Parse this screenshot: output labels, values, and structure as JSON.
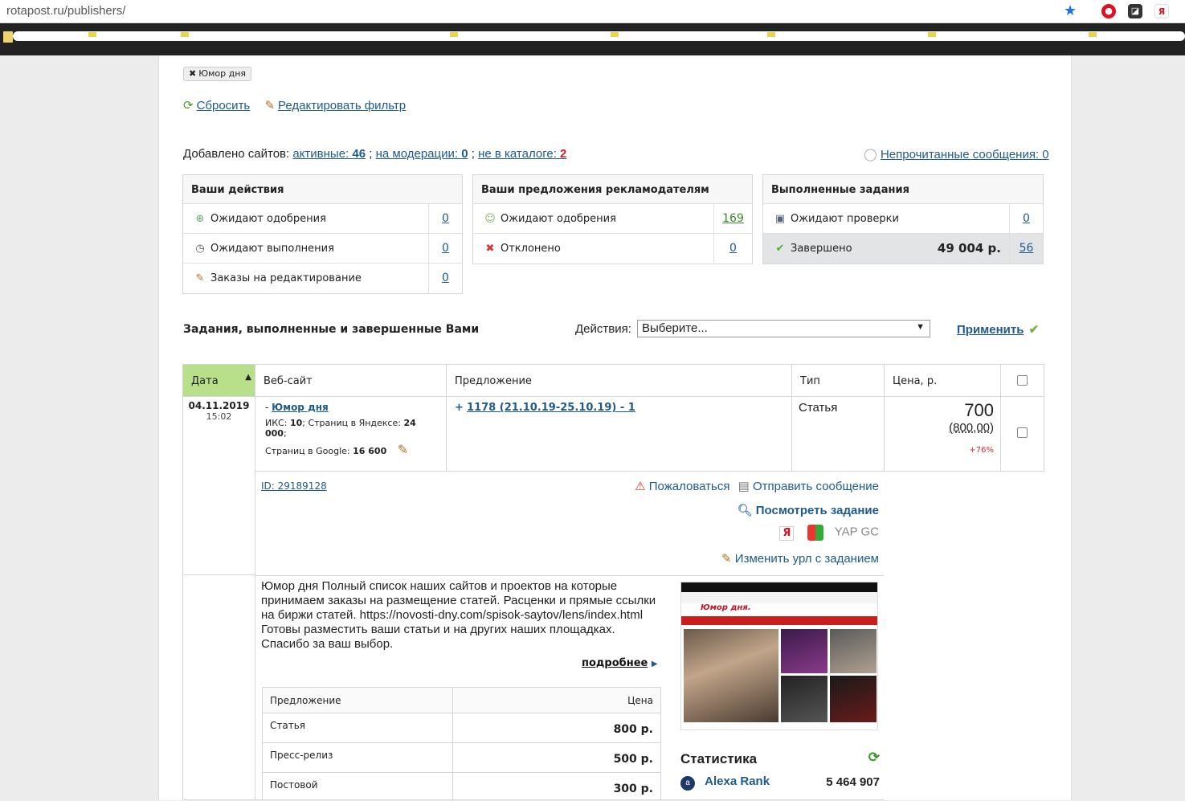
{
  "browser": {
    "url": "rotapost.ru/publishers/",
    "ext1": "●",
    "ext2": "◪",
    "ext3": "Я"
  },
  "filter": {
    "tag": "Юмор дня",
    "reset": "Сбросить",
    "edit": "Редактировать фильтр"
  },
  "sites": {
    "label": "Добавлено сайтов:",
    "active_label": "активные:",
    "active_count": "46",
    "moderation_label": "на модерации:",
    "moderation_count": "0",
    "not_catalog_label": "не в каталоге:",
    "not_catalog_count": "2",
    "sep": ";",
    "unread": "Непрочитанные сообщения: 0"
  },
  "panels": {
    "actions": {
      "title": "Ваши действия",
      "rows": [
        {
          "label": "Ожидают одобрения",
          "count": "0"
        },
        {
          "label": "Ожидают выполнения",
          "count": "0"
        },
        {
          "label": "Заказы на редактирование",
          "count": "0"
        }
      ]
    },
    "offers": {
      "title": "Ваши предложения рекламодателям",
      "rows": [
        {
          "label": "Ожидают одобрения",
          "count": "169"
        },
        {
          "label": "Отклонено",
          "count": "0"
        }
      ]
    },
    "completed": {
      "title": "Выполненные задания",
      "rows": [
        {
          "label": "Ожидают проверки",
          "count": "0"
        },
        {
          "label": "Завершено",
          "sum": "49 004 р.",
          "count": "56"
        }
      ]
    }
  },
  "section": {
    "title": "Задания, выполненные и завершенные Вами",
    "actions_label": "Действия:",
    "select_value": "Выберите...",
    "apply": "Применить"
  },
  "table": {
    "headers": {
      "date": "Дата",
      "site": "Веб-сайт",
      "offer": "Предложение",
      "type": "Тип",
      "price": "Цена, р."
    },
    "row": {
      "date": "04.11.2019",
      "time": "15:02",
      "site_prefix": "-",
      "site_name": "Юмор дня",
      "iks_label": "ИКС:",
      "iks": "10",
      "yandex_label": "; Страниц в Яндексе:",
      "yandex": "24 000",
      "yandex_end": ";",
      "google_label": "Страниц в Google:",
      "google": "16 600",
      "offer_prefix": "+",
      "offer_link": "1178 (21.10.19-25.10.19) - 1",
      "type": "Статья",
      "price": "700",
      "price_orig": "(800,00)",
      "percent": "+76%",
      "id": "ID: 29189128",
      "complain": "Пожаловаться",
      "send_message": "Отправить сообщение",
      "view_task": "Посмотреть задание",
      "yap": "YAP GC",
      "change_url": "Изменить урл с заданием"
    }
  },
  "detail": {
    "description": "Юмор дня Полный список наших сайтов и проектов на которые принимаем заказы на размещение статей. Расценки и прямые ссылки на биржи статей. https://novosti-dny.com/spisok-saytov/lens/index.html Готовы разместить ваши статьи и на других наших площадках. Спасибо за ваш выбор.",
    "more": "подробнее",
    "price_table": {
      "head_offer": "Предложение",
      "head_price": "Цена",
      "rows": [
        {
          "name": "Статья",
          "price": "800 р."
        },
        {
          "name": "Пресс-релиз",
          "price": "500 р."
        },
        {
          "name": "Постовой",
          "price": "300 р."
        }
      ]
    },
    "thumb_site": "Юмор дня.",
    "stats_title": "Статистика",
    "alexa_label": "Alexa Rank",
    "alexa_value": "5 464 907"
  }
}
